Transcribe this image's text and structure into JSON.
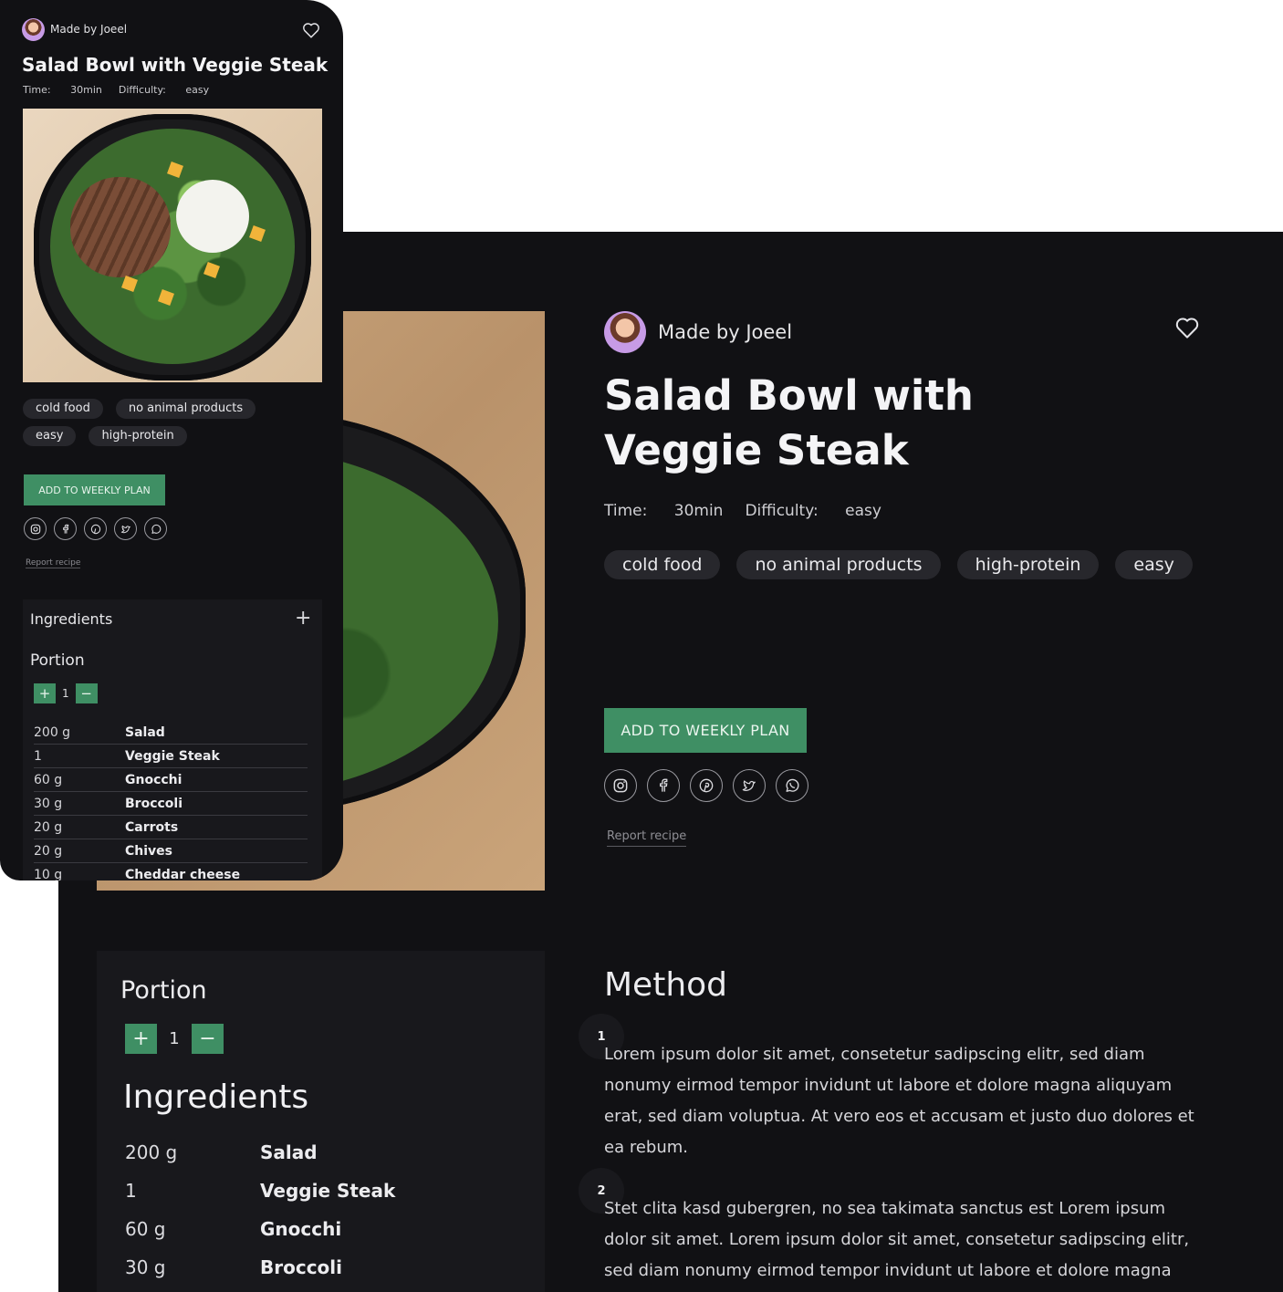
{
  "recipe": {
    "author": "Made by Joeel",
    "title": "Salad Bowl with Veggie Steak",
    "time_label": "Time:",
    "time_value": "30min",
    "difficulty_label": "Difficulty:",
    "difficulty_value": "easy",
    "tags_desktop": [
      "cold food",
      "no animal products",
      "high-protein",
      "easy"
    ],
    "tags_mobile": [
      "cold food",
      "no animal products",
      "easy",
      "high-protein"
    ],
    "add_button": "ADD TO WEEKLY PLAN",
    "report": "Report recipe",
    "social_icons": [
      "instagram-icon",
      "facebook-icon",
      "pinterest-icon",
      "twitter-icon",
      "whatsapp-icon"
    ]
  },
  "portion": {
    "label": "Portion",
    "value": "1",
    "plus": "+",
    "minus": "−"
  },
  "ingredients": {
    "title": "Ingredients",
    "items": [
      {
        "amount": "200 g",
        "name": "Salad"
      },
      {
        "amount": "1",
        "name": "Veggie Steak"
      },
      {
        "amount": "60 g",
        "name": "Gnocchi"
      },
      {
        "amount": "30 g",
        "name": "Broccoli"
      },
      {
        "amount": "20 g",
        "name": "Carrots"
      },
      {
        "amount": "20 g",
        "name": "Chives"
      },
      {
        "amount": "10 g",
        "name": "Cheddar cheese"
      }
    ]
  },
  "method": {
    "title": "Method",
    "steps": [
      {
        "num": "1",
        "text": "Lorem ipsum dolor sit amet, consetetur sadipscing elitr, sed diam nonumy eirmod tempor invidunt ut labore et dolore magna aliquyam erat, sed diam voluptua. At vero eos et accusam et justo duo dolores et ea rebum."
      },
      {
        "num": "2",
        "text": "Stet clita kasd gubergren, no sea takimata sanctus est Lorem ipsum dolor sit amet. Lorem ipsum dolor sit amet, consetetur sadipscing elitr, sed diam nonumy eirmod tempor invidunt ut labore et dolore magna"
      }
    ]
  },
  "mobile": {
    "ingredients_plus": "+"
  },
  "colors": {
    "background": "#111114",
    "accent": "#3f8f64",
    "tag": "#27272c",
    "panel": "#18181c"
  }
}
